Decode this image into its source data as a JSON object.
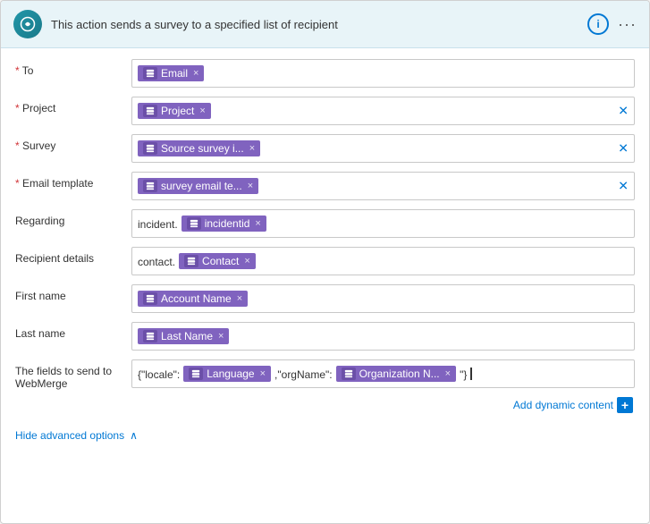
{
  "header": {
    "title": "This action sends a survey to a specified list of recipient",
    "info_label": "i",
    "more_label": "···"
  },
  "fields": [
    {
      "id": "to",
      "label": "To",
      "required": true,
      "tags": [
        {
          "text": "Email",
          "icon": true
        }
      ],
      "has_clear": false,
      "prefix": null
    },
    {
      "id": "project",
      "label": "Project",
      "required": true,
      "tags": [
        {
          "text": "Project",
          "icon": true
        }
      ],
      "has_clear": true,
      "prefix": null
    },
    {
      "id": "survey",
      "label": "Survey",
      "required": true,
      "tags": [
        {
          "text": "Source survey i...",
          "icon": true
        }
      ],
      "has_clear": true,
      "prefix": null
    },
    {
      "id": "email_template",
      "label": "Email template",
      "required": true,
      "tags": [
        {
          "text": "survey email te...",
          "icon": true
        }
      ],
      "has_clear": true,
      "prefix": null
    },
    {
      "id": "regarding",
      "label": "Regarding",
      "required": false,
      "tags": [
        {
          "text": "incidentid",
          "icon": true
        }
      ],
      "has_clear": false,
      "prefix": "incident."
    },
    {
      "id": "recipient_details",
      "label": "Recipient details",
      "required": false,
      "tags": [
        {
          "text": "Contact",
          "icon": true
        }
      ],
      "has_clear": false,
      "prefix": "contact."
    },
    {
      "id": "first_name",
      "label": "First name",
      "required": false,
      "tags": [
        {
          "text": "Account Name",
          "icon": true
        }
      ],
      "has_clear": false,
      "prefix": null
    },
    {
      "id": "last_name",
      "label": "Last name",
      "required": false,
      "tags": [
        {
          "text": "Last Name",
          "icon": true
        }
      ],
      "has_clear": false,
      "prefix": null
    }
  ],
  "webmerge": {
    "label": "The fields to send to WebMerge",
    "prefix1": "{\"locale\":",
    "tag1": "Language",
    "middle": ",\"orgName\":",
    "tag2": "Organization N...",
    "suffix": " \"}"
  },
  "dynamic_content": {
    "text": "Add dynamic content",
    "btn": "+"
  },
  "hide_advanced": {
    "text": "Hide advanced options",
    "icon": "∧"
  }
}
